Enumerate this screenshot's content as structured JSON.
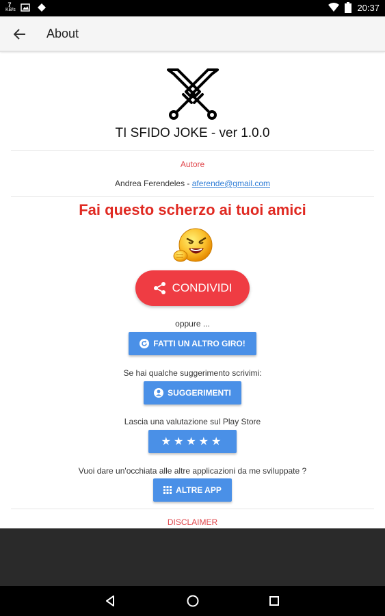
{
  "status_bar": {
    "kb_value": "7",
    "kb_unit": "KB/s",
    "time": "20:37"
  },
  "app_bar": {
    "title": "About"
  },
  "app_info": {
    "name": "TI SFIDO JOKE - ver 1.0.0",
    "author_label": "Autore",
    "author_name": "Andrea Ferendeles - ",
    "author_email": "aferende@gmail.com"
  },
  "promo": {
    "headline": "Fai questo scherzo ai tuoi amici",
    "share_label": "CONDIVIDI"
  },
  "actions": {
    "or_text": "oppure ...",
    "again_label": "FATTI UN ALTRO GIRO!",
    "suggest_text": "Se hai qualche suggerimento scrivimi:",
    "suggest_label": "SUGGERIMENTI",
    "rate_text": "Lascia una valutazione sul Play Store",
    "rate_stars": "★★★★★",
    "more_text": "Vuoi dare un'occhiata alle altre applicazioni da me sviluppate ?",
    "more_label": "ALTRE APP",
    "disclaimer": "DISCLAIMER"
  },
  "colors": {
    "accent_red": "#ef3c43",
    "button_blue": "#4a90e7",
    "headline_red": "#e02a22",
    "link_blue": "#2f7dd6"
  },
  "icons": [
    "back-arrow-icon",
    "crossed-swords-icon",
    "laughing-emoji-icon",
    "share-icon",
    "refresh-icon",
    "account-icon",
    "grid-icon",
    "wifi-icon",
    "battery-icon",
    "image-icon",
    "tag-icon"
  ]
}
